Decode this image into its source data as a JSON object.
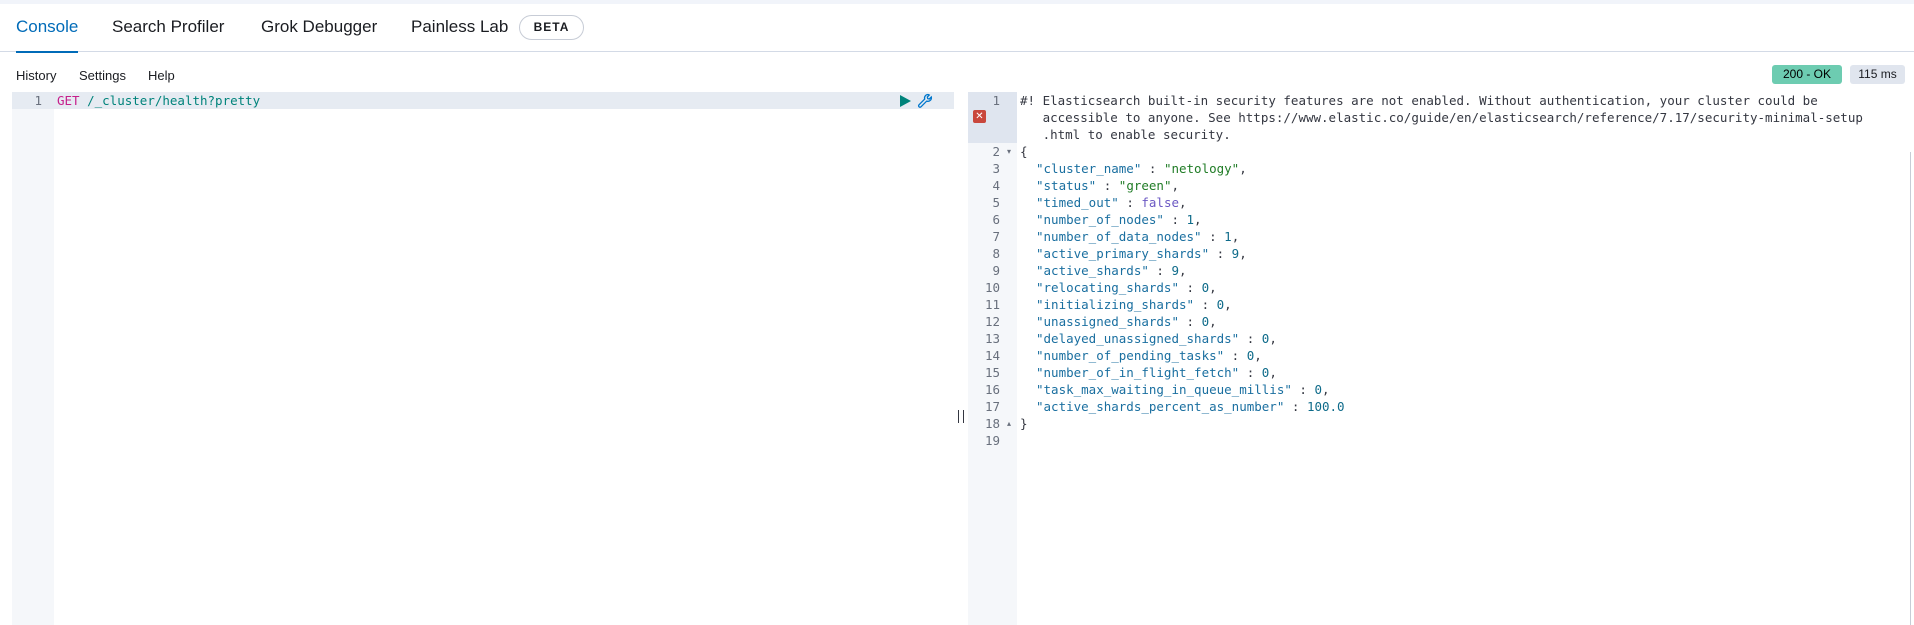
{
  "tabs": [
    {
      "label": "Console",
      "active": true
    },
    {
      "label": "Search Profiler",
      "active": false
    },
    {
      "label": "Grok Debugger",
      "active": false
    },
    {
      "label": "Painless Lab",
      "active": false
    }
  ],
  "beta_badge": "BETA",
  "menu": {
    "history": "History",
    "settings": "Settings",
    "help": "Help"
  },
  "response_status": "200 - OK",
  "response_time": "115 ms",
  "request": {
    "line_number": "1",
    "method": "GET",
    "path": "/_cluster/health?pretty"
  },
  "response": {
    "warning_lines": [
      "#! Elasticsearch built-in security features are not enabled. Without authentication, your cluster could be",
      "   accessible to anyone. See https://www.elastic.co/guide/en/elasticsearch/reference/7.17/security-minimal-setup",
      "   .html to enable security."
    ],
    "open_brace": "{",
    "close_brace": "}",
    "fields": [
      {
        "key": "\"cluster_name\"",
        "value": "\"netology\"",
        "type": "str"
      },
      {
        "key": "\"status\"",
        "value": "\"green\"",
        "type": "str"
      },
      {
        "key": "\"timed_out\"",
        "value": "false",
        "type": "bool"
      },
      {
        "key": "\"number_of_nodes\"",
        "value": "1",
        "type": "num"
      },
      {
        "key": "\"number_of_data_nodes\"",
        "value": "1",
        "type": "num"
      },
      {
        "key": "\"active_primary_shards\"",
        "value": "9",
        "type": "num"
      },
      {
        "key": "\"active_shards\"",
        "value": "9",
        "type": "num"
      },
      {
        "key": "\"relocating_shards\"",
        "value": "0",
        "type": "num"
      },
      {
        "key": "\"initializing_shards\"",
        "value": "0",
        "type": "num"
      },
      {
        "key": "\"unassigned_shards\"",
        "value": "0",
        "type": "num"
      },
      {
        "key": "\"delayed_unassigned_shards\"",
        "value": "0",
        "type": "num"
      },
      {
        "key": "\"number_of_pending_tasks\"",
        "value": "0",
        "type": "num"
      },
      {
        "key": "\"number_of_in_flight_fetch\"",
        "value": "0",
        "type": "num"
      },
      {
        "key": "\"task_max_waiting_in_queue_millis\"",
        "value": "0",
        "type": "num"
      },
      {
        "key": "\"active_shards_percent_as_number\"",
        "value": "100.0",
        "type": "num"
      }
    ],
    "line_numbers": [
      "1",
      "2",
      "3",
      "4",
      "5",
      "6",
      "7",
      "8",
      "9",
      "10",
      "11",
      "12",
      "13",
      "14",
      "15",
      "16",
      "17",
      "18",
      "19"
    ]
  }
}
